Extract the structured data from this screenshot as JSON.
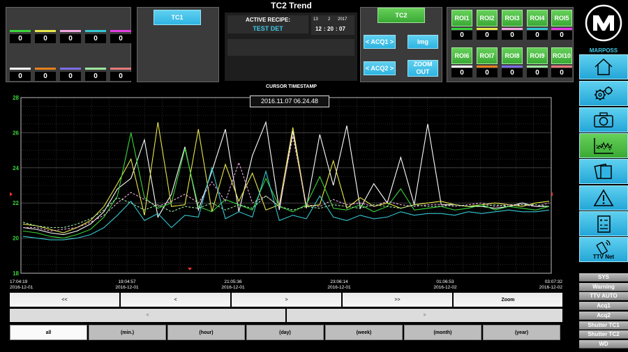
{
  "header": {
    "title": "TC2 Trend"
  },
  "counters": [
    {
      "color": "#39d53a",
      "value": "0"
    },
    {
      "color": "#e8e84a",
      "value": "0"
    },
    {
      "color": "#f0a8e0",
      "value": "0"
    },
    {
      "color": "#34c8d2",
      "value": "0"
    },
    {
      "color": "#e33ee3",
      "value": "0"
    },
    {
      "color": "#ffffff",
      "value": "0"
    },
    {
      "color": "#e8801e",
      "value": "0"
    },
    {
      "color": "#7b6ee8",
      "value": "0"
    },
    {
      "color": "#9ee8a0",
      "value": "0"
    },
    {
      "color": "#e87a7a",
      "value": "0"
    }
  ],
  "tc1_label": "TC1",
  "recipe": {
    "label": "ACTIVE RECIPE:",
    "value": "TEST DET"
  },
  "date": {
    "day": "13",
    "month": "2",
    "year": "2017"
  },
  "time": {
    "hh": "12",
    "mm": "20",
    "ss": "07"
  },
  "controls": {
    "tc2": "TC2",
    "acq1": "< ACQ1 >",
    "img": "Img",
    "acq2": "< ACQ2 >",
    "zoom_out": "ZOOM OUT"
  },
  "roi": [
    {
      "label": "ROI1",
      "color": "#39d53a",
      "value": "0"
    },
    {
      "label": "ROI2",
      "color": "#e8e84a",
      "value": "0"
    },
    {
      "label": "ROI3",
      "color": "#f0a8e0",
      "value": "0"
    },
    {
      "label": "ROI4",
      "color": "#34c8d2",
      "value": "0"
    },
    {
      "label": "ROI5",
      "color": "#e33ee3",
      "value": "0"
    },
    {
      "label": "ROI6",
      "color": "#ffffff",
      "value": "0"
    },
    {
      "label": "ROI7",
      "color": "#e8801e",
      "value": "0"
    },
    {
      "label": "ROI8",
      "color": "#7b6ee8",
      "value": "0"
    },
    {
      "label": "ROI9",
      "color": "#9ee8a0",
      "value": "0"
    },
    {
      "label": "ROI10",
      "color": "#e87a7a",
      "value": "0"
    }
  ],
  "logo": "MARPOSS",
  "cursor": {
    "label": "CURSOR TIMESTAMP",
    "value": "2016.11.07 06.24.48"
  },
  "nav": {
    "first": "<<",
    "prev": "<",
    "next": ">",
    "last": ">>",
    "zoom": "Zoom",
    "scroll_left": "<",
    "scroll_right": ">"
  },
  "ranges": [
    "all",
    "(min.)",
    "(hour)",
    "(day)",
    "(week)",
    "(month)",
    "(year)"
  ],
  "side_buttons": [
    "home",
    "settings",
    "camera",
    "trend",
    "gallery",
    "warning",
    "report",
    "ttv-net"
  ],
  "ttv_net_label": "TTV Net",
  "side_menu": [
    "SYS",
    "Warning",
    "TTV AUTO",
    "Acq1",
    "Acq2",
    "Shutter TC1",
    "Shutter TC2",
    "WD"
  ],
  "chart_data": {
    "type": "line",
    "ylim": [
      18,
      28
    ],
    "yticks": [
      "18",
      "20",
      "22",
      "24",
      "26",
      "28"
    ],
    "xticks": [
      {
        "time": "17:04:19",
        "date": "2016-12-01"
      },
      {
        "time": "19:04:57",
        "date": "2016-12-01"
      },
      {
        "time": "21:05:36",
        "date": "2016-12-01"
      },
      {
        "time": "23:06:14",
        "date": "2016-12-01"
      },
      {
        "time": "01:06:53",
        "date": "2016-12-02"
      },
      {
        "time": "03:07:32",
        "date": "2016-12-02"
      }
    ],
    "grid": true,
    "series": [
      {
        "color": "#ffffff",
        "dash": false,
        "values": [
          20.6,
          20.5,
          20.3,
          20.2,
          20.4,
          20.8,
          21.5,
          22.8,
          23.4,
          25.6,
          21.2,
          22.5,
          25.2,
          21.6,
          23.8,
          26.2,
          21.5,
          24.7,
          26.6,
          21.6,
          26.1,
          21.7,
          25.9,
          23.0,
          26.4,
          21.7,
          23.1,
          22.0,
          24.6,
          21.9,
          26.5,
          21.9,
          21.9,
          21.8,
          21.8,
          21.7,
          21.8,
          22.0,
          21.8,
          21.8
        ]
      },
      {
        "color": "#e8e84a",
        "dash": false,
        "values": [
          20.8,
          20.7,
          20.5,
          20.3,
          20.6,
          21.0,
          21.8,
          23.1,
          24.5,
          21.3,
          26.6,
          21.8,
          21.9,
          26.2,
          21.5,
          24.2,
          22.1,
          23.7,
          21.6,
          21.9,
          26.3,
          21.8,
          21.9,
          24.4,
          21.7,
          22.3,
          21.8,
          22.0,
          21.7,
          21.9,
          22.0,
          22.1,
          21.9,
          21.8,
          21.9,
          22.0,
          21.9,
          21.8,
          22.0,
          22.1
        ]
      },
      {
        "color": "#39d53a",
        "dash": false,
        "values": [
          20.4,
          20.3,
          20.1,
          20.0,
          20.2,
          20.5,
          21.2,
          22.4,
          26.0,
          22.3,
          21.7,
          22.0,
          25.1,
          21.8,
          21.5,
          22.2,
          21.9,
          21.6,
          23.4,
          21.8,
          21.5,
          21.9,
          23.5,
          21.7,
          21.6,
          21.9,
          21.5,
          21.8,
          22.8,
          21.6,
          21.7,
          21.8,
          21.6,
          21.7,
          21.9,
          21.6,
          21.8,
          21.7,
          21.6,
          21.8
        ]
      },
      {
        "color": "#34c8d2",
        "dash": false,
        "values": [
          20.1,
          20.0,
          19.9,
          19.9,
          20.0,
          20.2,
          20.6,
          21.3,
          22.1,
          21.0,
          21.4,
          20.6,
          21.3,
          21.2,
          24.0,
          21.1,
          21.5,
          21.2,
          23.8,
          21.0,
          21.3,
          21.1,
          22.4,
          21.2,
          21.0,
          21.3,
          21.1,
          21.2,
          21.5,
          21.3,
          21.4,
          21.4,
          21.3,
          21.5,
          21.4,
          21.5,
          21.6,
          21.5,
          21.5,
          21.6
        ]
      },
      {
        "color": "#f0a8e0",
        "dash": true,
        "values": [
          20.6,
          20.6,
          20.4,
          20.5,
          20.6,
          20.9,
          21.3,
          22.0,
          22.6,
          22.2,
          21.8,
          22.1,
          22.5,
          22.0,
          23.2,
          22.1,
          24.3,
          22.0,
          22.4,
          21.8,
          25.8,
          21.9,
          21.8,
          22.2,
          21.9,
          22.0,
          21.8,
          22.1,
          21.9,
          21.8,
          21.9,
          21.9,
          21.8,
          21.9,
          22.0,
          21.8,
          21.9,
          21.9,
          21.8,
          22.0
        ]
      },
      {
        "color": "#9ee8a0",
        "dash": true,
        "values": [
          20.9,
          20.7,
          20.6,
          20.6,
          20.8,
          21.1,
          21.6,
          22.3,
          22.0,
          21.6,
          21.9,
          21.5,
          21.8,
          21.7,
          22.0,
          21.6,
          21.9,
          21.7,
          22.4,
          21.8,
          21.6,
          21.8,
          21.7,
          21.9,
          21.8,
          21.7,
          21.9,
          21.8,
          21.7,
          21.9,
          21.8,
          21.8,
          21.9,
          21.8,
          21.8,
          21.9,
          21.8,
          21.9,
          21.9,
          21.8
        ]
      }
    ]
  }
}
